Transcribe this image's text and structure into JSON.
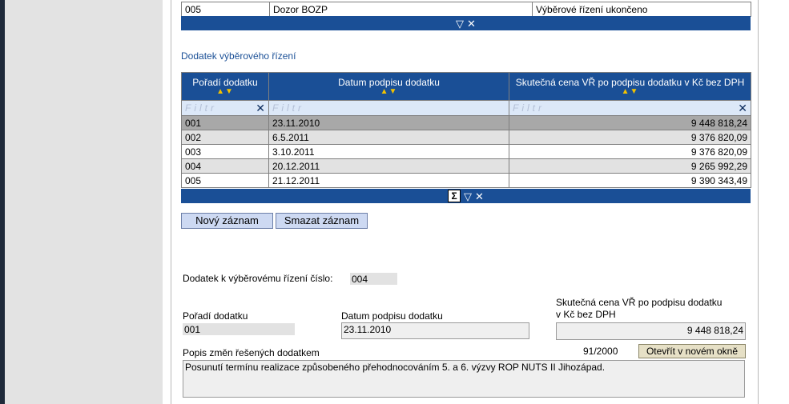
{
  "top_table": {
    "row": {
      "code": "005",
      "name": "Dozor BOZP",
      "status": "Výběrové řízení ukončeno"
    }
  },
  "section_title": "Dodatek výběrového řízení",
  "dodatek_table": {
    "headers": [
      "Pořadí dodatku",
      "Datum podpisu dodatku",
      "Skutečná cena VŘ po podpisu dodatku v Kč bez DPH"
    ],
    "filter_placeholder": "Filtr",
    "rows": [
      {
        "poradi": "001",
        "datum": "23.11.2010",
        "cena": "9 448 818,24"
      },
      {
        "poradi": "002",
        "datum": "6.5.2011",
        "cena": "9 376 820,09"
      },
      {
        "poradi": "003",
        "datum": "3.10.2011",
        "cena": "9 376 820,09"
      },
      {
        "poradi": "004",
        "datum": "20.12.2011",
        "cena": "9 265 992,29"
      },
      {
        "poradi": "005",
        "datum": "21.12.2011",
        "cena": "9 390 343,49"
      }
    ]
  },
  "buttons": {
    "new": "Nový záznam",
    "delete": "Smazat záznam",
    "open_new_window": "Otevřít v novém okně"
  },
  "form": {
    "dodatek_cislo_label": "Dodatek k výběrovému řízení číslo:",
    "dodatek_cislo_value": "004",
    "poradi_label": "Pořadí dodatku",
    "poradi_value": "001",
    "datum_label": "Datum podpisu dodatku",
    "datum_value": "23.11.2010",
    "cena_label_line1": "Skutečná cena VŘ po podpisu dodatku",
    "cena_label_line2": "v Kč bez DPH",
    "cena_value": "9 448 818,24",
    "popis_label": "Popis změn řešených dodatkem",
    "counter": "91/2000",
    "popis_value": "Posunutí termínu realizace způsobeného přehodnocováním 5. a 6. výzvy ROP NUTS II Jihozápad."
  },
  "icons": {
    "filter": "filter-icon",
    "clear": "close-icon",
    "sum": "sigma-icon",
    "sort": "sort-arrows-icon"
  }
}
